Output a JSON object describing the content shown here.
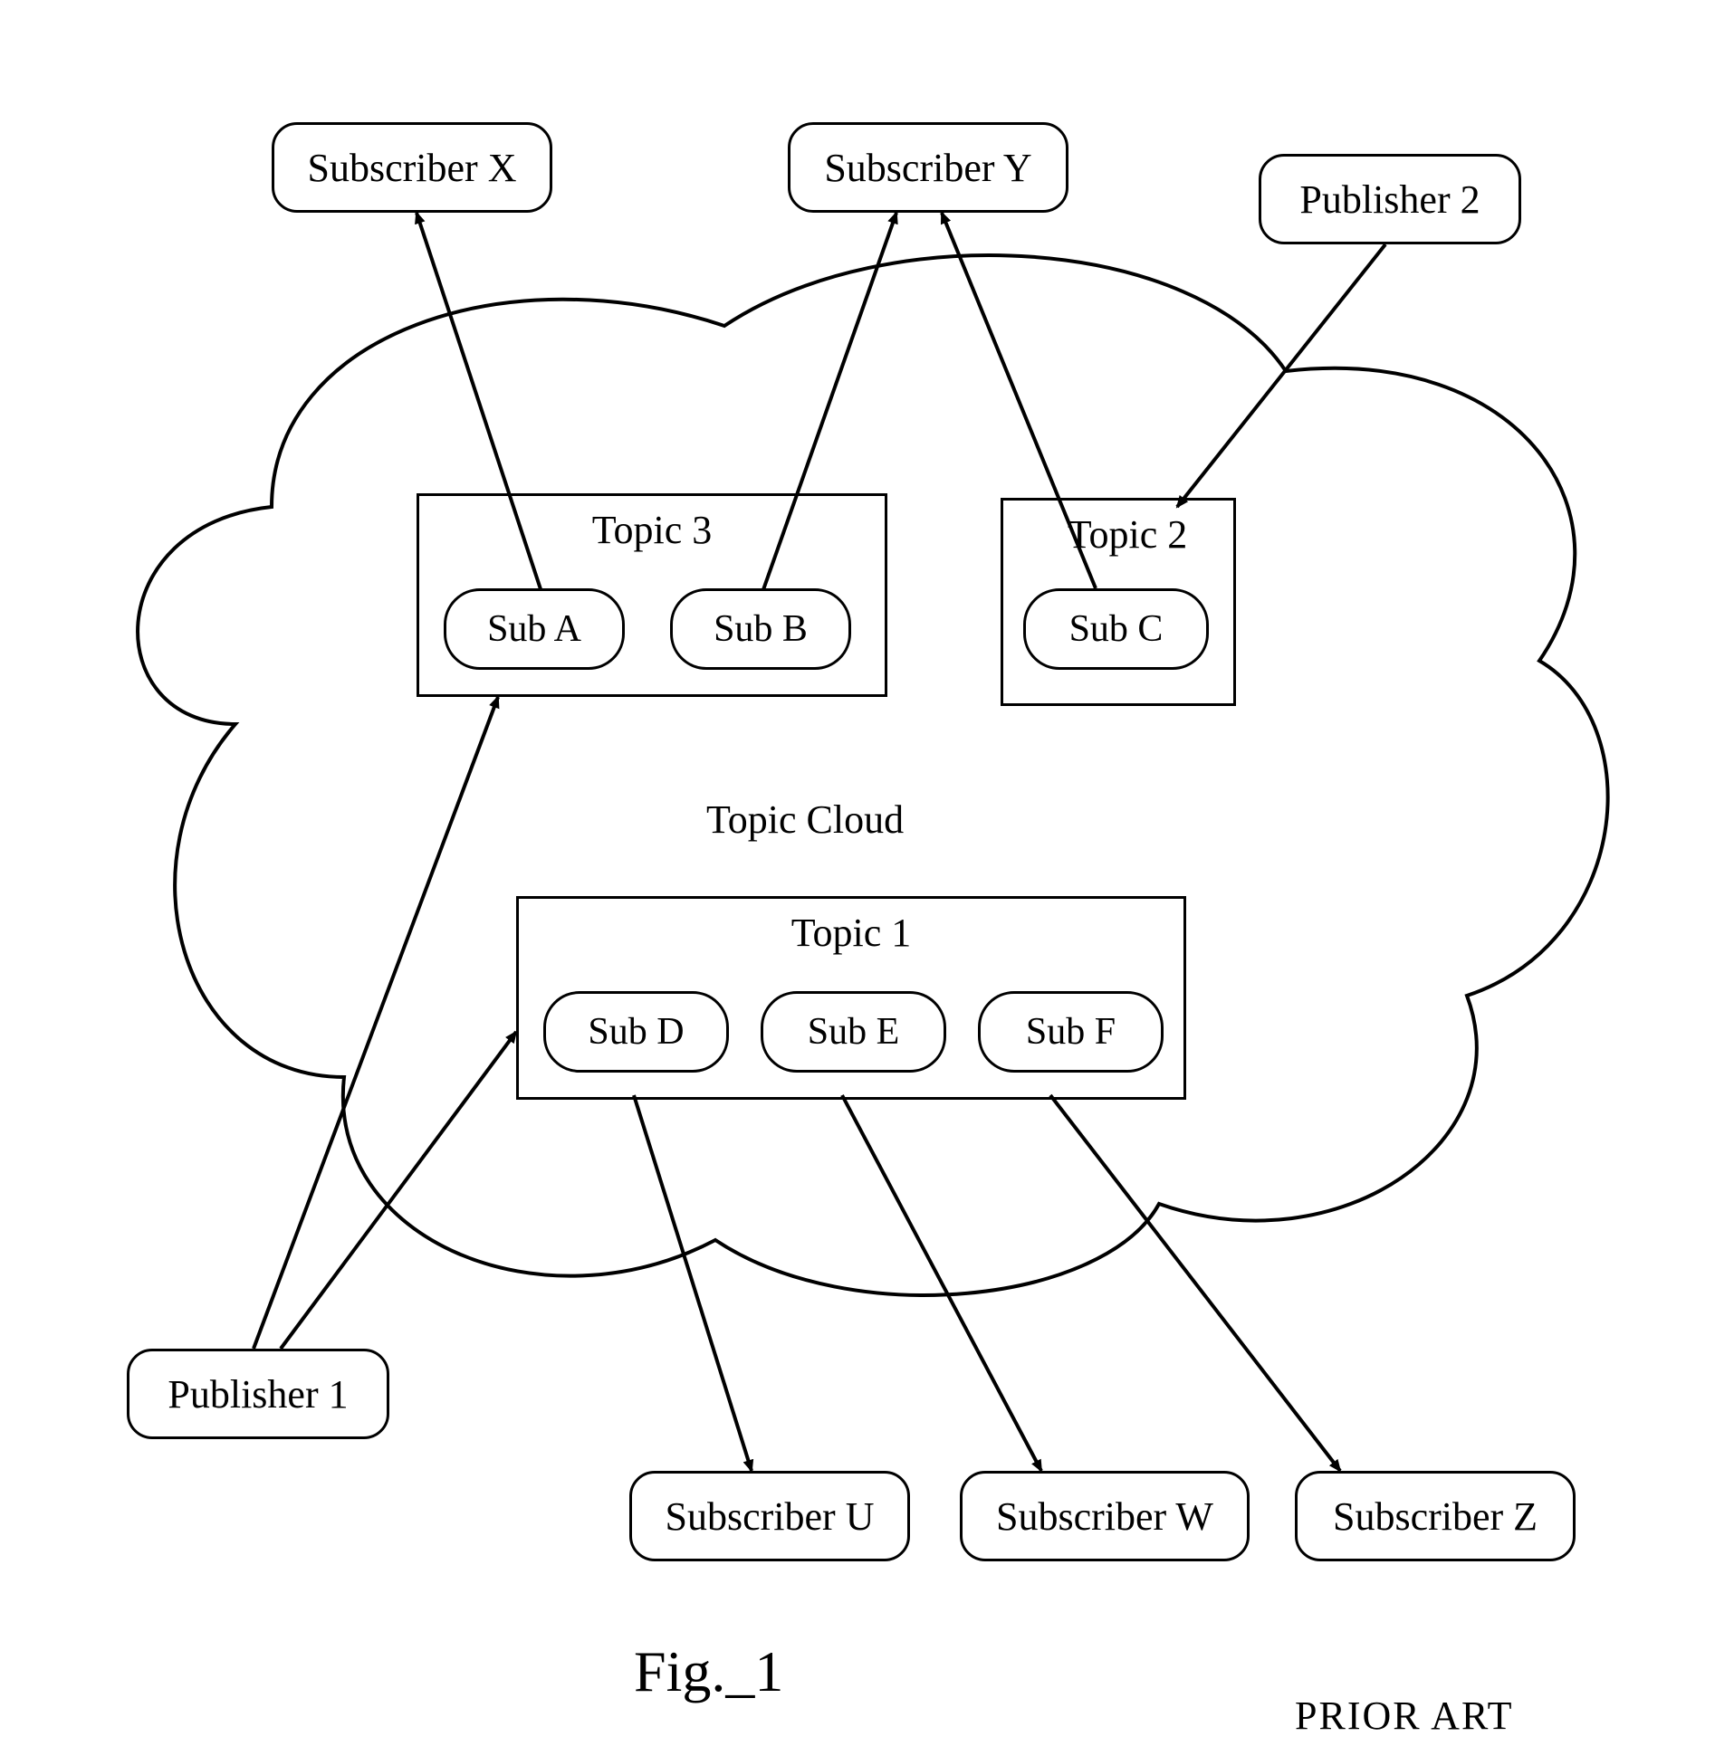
{
  "figure_label": "Fig._1",
  "prior_art": "PRIOR ART",
  "cloud_label": "Topic Cloud",
  "subscribers": {
    "x": "Subscriber X",
    "y": "Subscriber Y",
    "u": "Subscriber U",
    "w": "Subscriber W",
    "z": "Subscriber Z"
  },
  "publishers": {
    "1": "Publisher 1",
    "2": "Publisher 2"
  },
  "topics": {
    "1": {
      "label": "Topic 1",
      "subs": {
        "d": "Sub D",
        "e": "Sub E",
        "f": "Sub F"
      }
    },
    "2": {
      "label": "Topic 2",
      "subs": {
        "c": "Sub C"
      }
    },
    "3": {
      "label": "Topic 3",
      "subs": {
        "a": "Sub A",
        "b": "Sub B"
      }
    }
  },
  "arrows": [
    {
      "from": "Publisher 1",
      "to": "Topic 3"
    },
    {
      "from": "Publisher 1",
      "to": "Topic 1"
    },
    {
      "from": "Publisher 2",
      "to": "Topic 2"
    },
    {
      "from": "Sub A",
      "to": "Subscriber X"
    },
    {
      "from": "Sub B",
      "to": "Subscriber Y"
    },
    {
      "from": "Sub C",
      "to": "Subscriber Y"
    },
    {
      "from": "Sub D",
      "to": "Subscriber U"
    },
    {
      "from": "Sub E",
      "to": "Subscriber W"
    },
    {
      "from": "Sub F",
      "to": "Subscriber Z"
    }
  ]
}
